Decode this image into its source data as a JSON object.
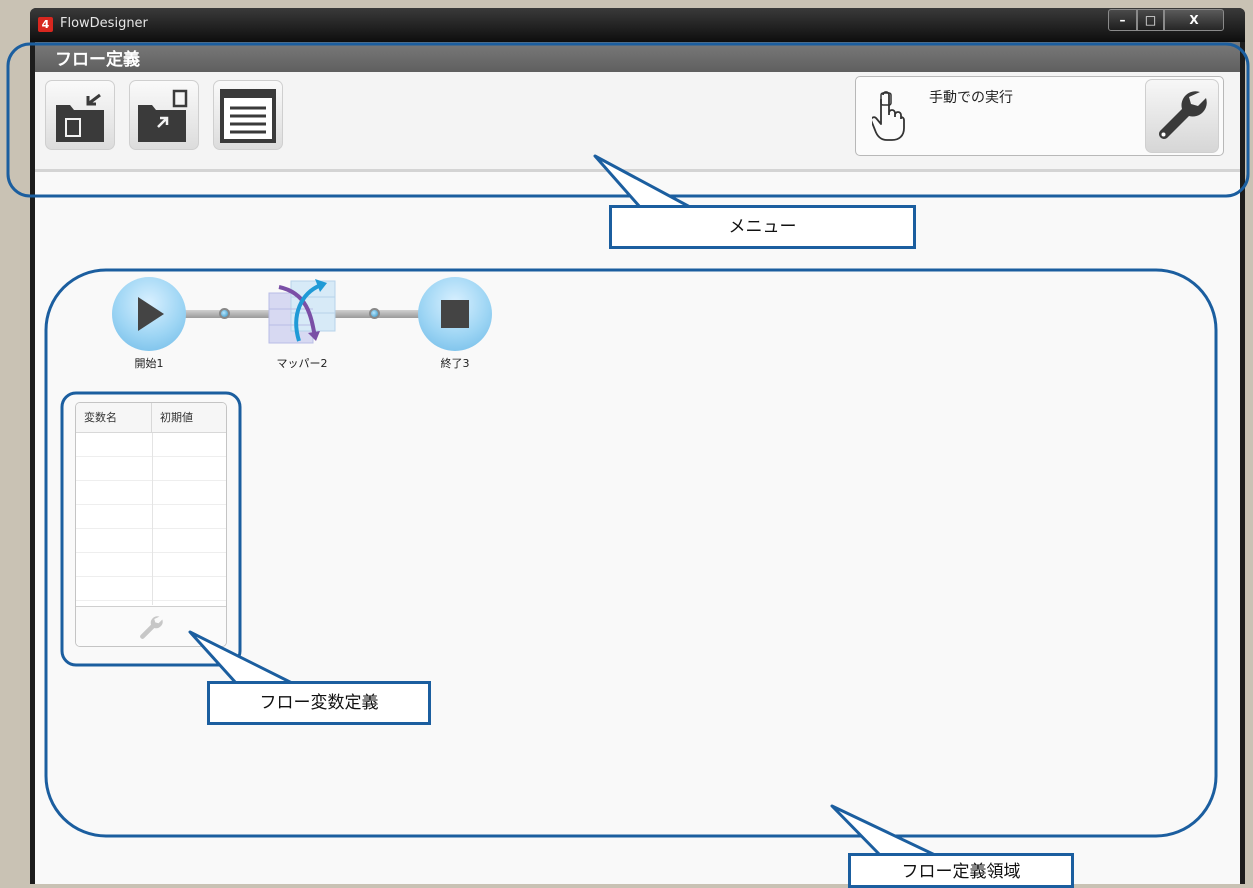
{
  "window": {
    "title": "FlowDesigner",
    "app_icon_glyph": "4",
    "controls": {
      "minimize": "–",
      "maximize": "□",
      "close": "X"
    }
  },
  "header": {
    "title": "フロー定義"
  },
  "toolbar": {
    "buttons": [
      {
        "name": "import-button",
        "icon": "folder-import-icon"
      },
      {
        "name": "export-button",
        "icon": "folder-export-icon"
      },
      {
        "name": "properties-button",
        "icon": "document-list-icon"
      }
    ],
    "manual_run_label": "手動での実行",
    "settings_icon": "wrench-icon"
  },
  "flow": {
    "nodes": [
      {
        "label": "開始1",
        "icon": "play-icon"
      },
      {
        "label": "マッパー2",
        "icon": "mapper-icon"
      },
      {
        "label": "終了3",
        "icon": "stop-icon"
      }
    ]
  },
  "variables": {
    "columns": [
      "変数名",
      "初期値"
    ],
    "rows": [],
    "settings_icon": "wrench-icon"
  },
  "annotations": {
    "menu": "メニュー",
    "flow_variable": "フロー変数定義",
    "flow_area": "フロー定義領域"
  },
  "colors": {
    "annotation": "#1b5e9f",
    "header": "#6b6b6b",
    "node": "#9dd5f4"
  }
}
